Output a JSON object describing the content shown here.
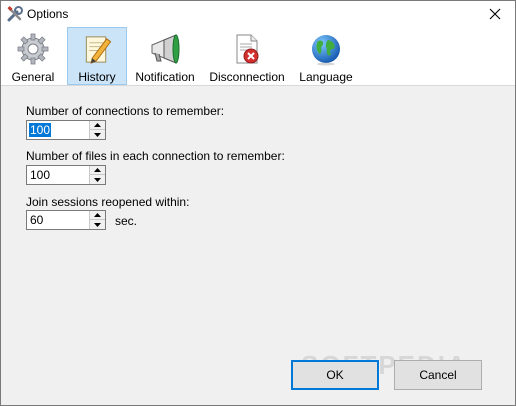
{
  "window": {
    "title": "Options",
    "title_icon": "tools-icon",
    "close_icon": "close-icon"
  },
  "tabs": [
    {
      "label": "General",
      "icon": "gear-icon",
      "active": false
    },
    {
      "label": "History",
      "icon": "pencil-note-icon",
      "active": true
    },
    {
      "label": "Notification",
      "icon": "megaphone-icon",
      "active": false
    },
    {
      "label": "Disconnection",
      "icon": "document-error-icon",
      "active": false
    },
    {
      "label": "Language",
      "icon": "globe-icon",
      "active": false
    }
  ],
  "history": {
    "connections_label": "Number of connections to remember:",
    "connections_value": "100",
    "files_label": "Number of files in each connection to remember:",
    "files_value": "100",
    "sessions_label": "Join sessions reopened within:",
    "sessions_value": "60",
    "sessions_unit": "sec."
  },
  "buttons": {
    "ok": "OK",
    "cancel": "Cancel"
  },
  "watermark": "SOFTPEDIA",
  "colors": {
    "accent": "#0078d7",
    "active_tab_bg": "#cce4f7",
    "dialog_bg": "#f0f0f0"
  }
}
